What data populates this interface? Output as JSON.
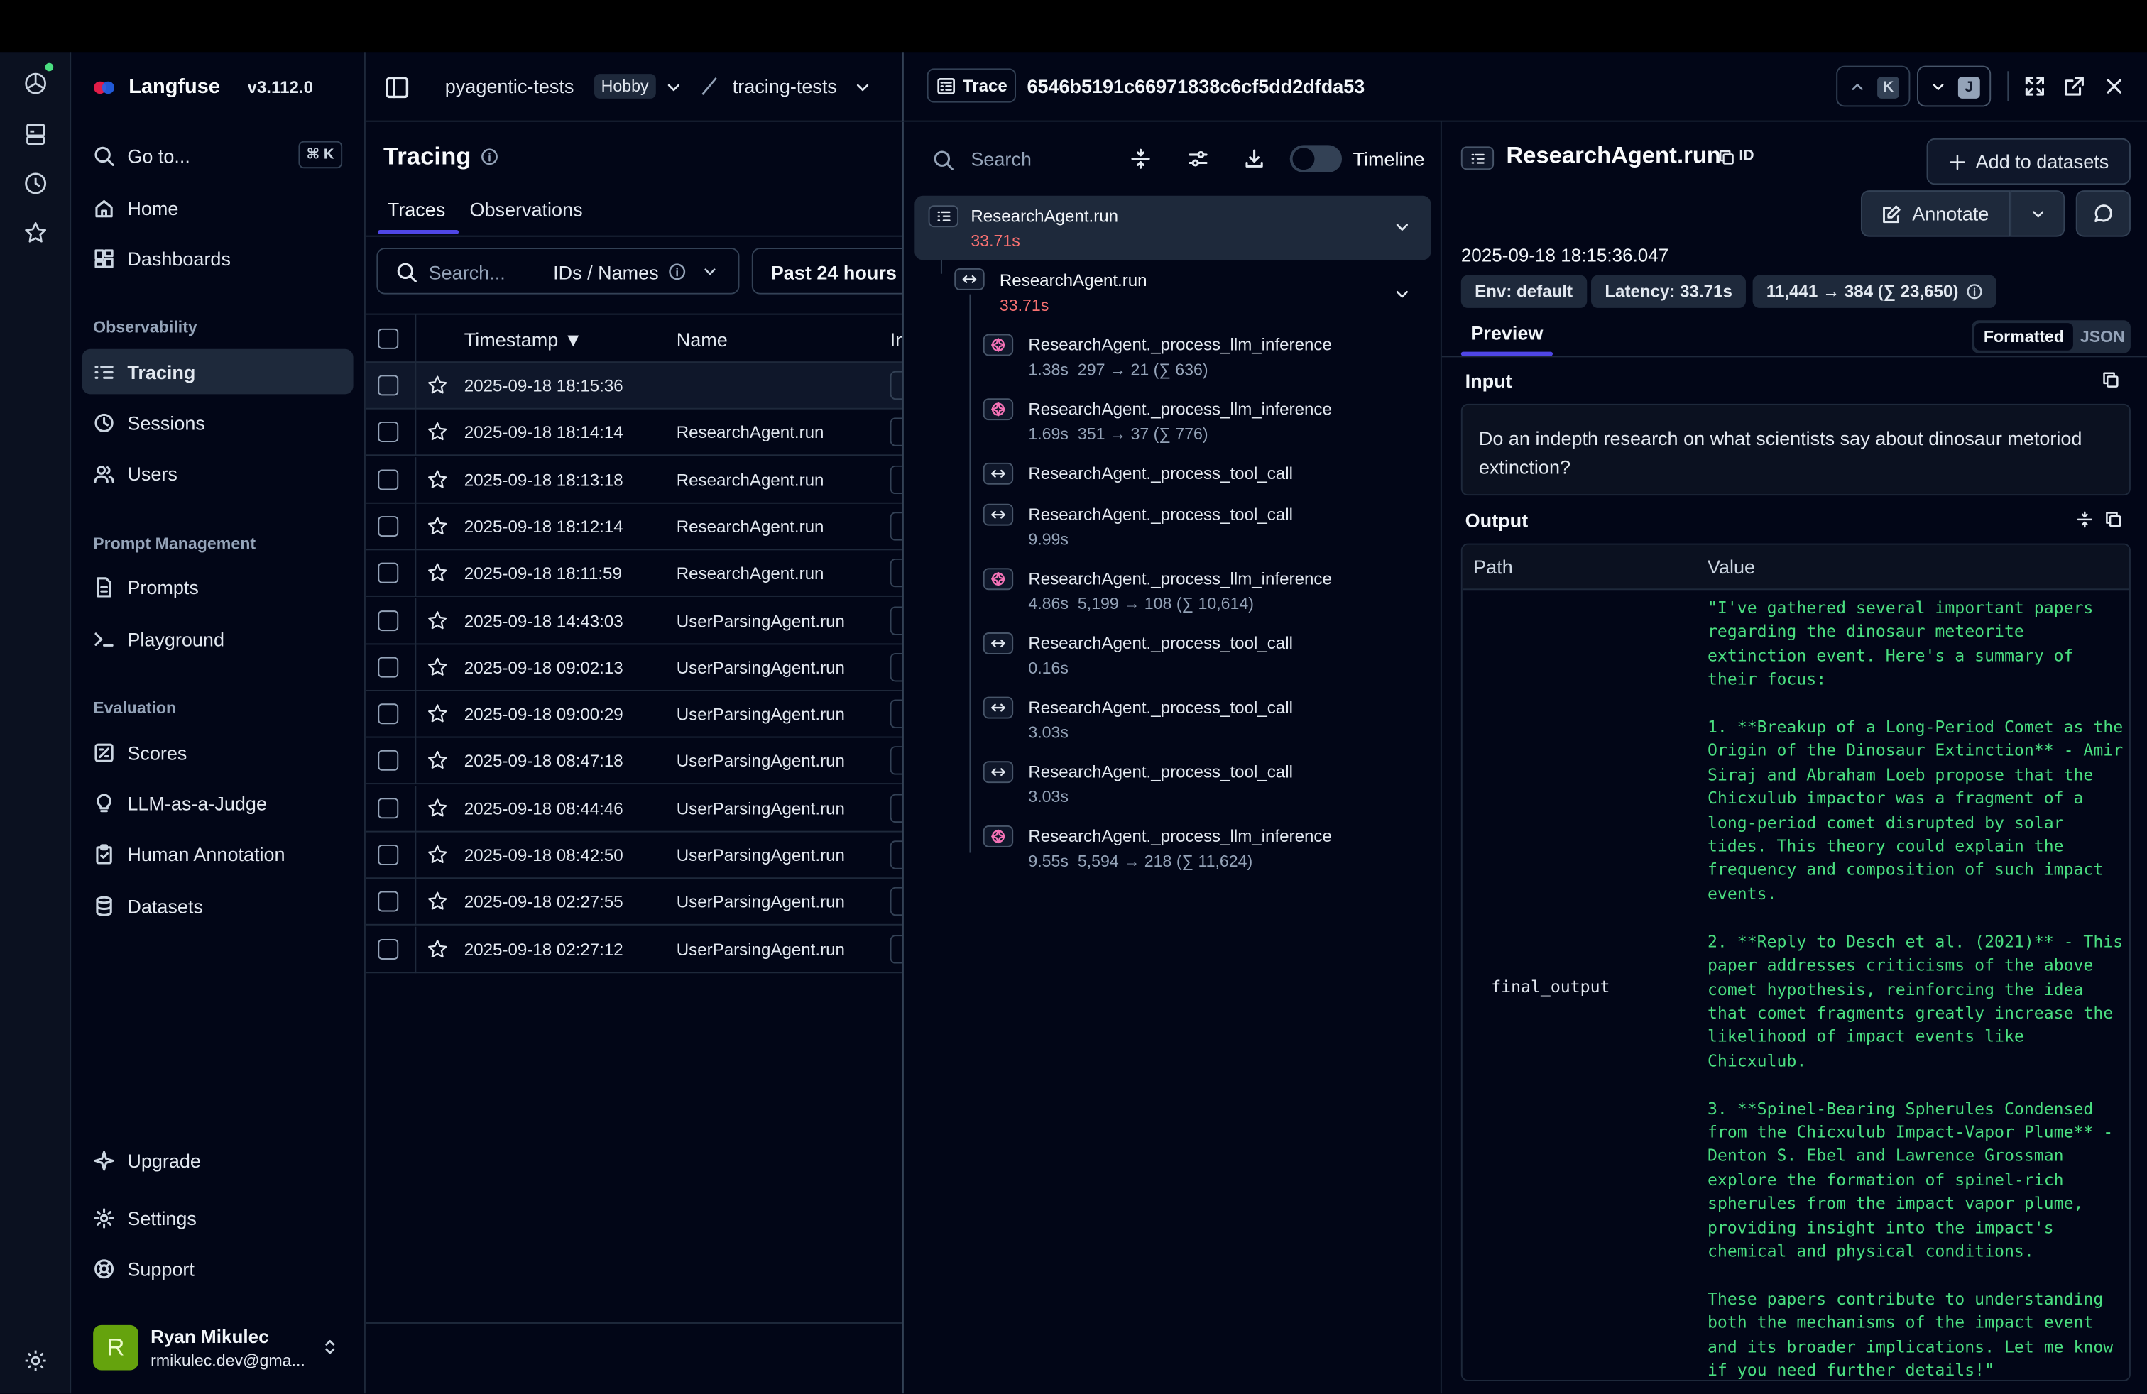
{
  "app": {
    "name": "Langfuse",
    "version": "v3.112.0"
  },
  "breadcrumb": {
    "project_org": "pyagentic-tests",
    "plan_badge": "Hobby",
    "project": "tracing-tests"
  },
  "sidebar": {
    "goto_label": "Go to...",
    "goto_shortcut": "⌘ K",
    "home": "Home",
    "dashboards": "Dashboards",
    "section_observability": "Observability",
    "tracing": "Tracing",
    "sessions": "Sessions",
    "users": "Users",
    "section_prompt": "Prompt Management",
    "prompts": "Prompts",
    "playground": "Playground",
    "section_evaluation": "Evaluation",
    "scores": "Scores",
    "llm_judge": "LLM-as-a-Judge",
    "human_annotation": "Human Annotation",
    "datasets": "Datasets",
    "upgrade": "Upgrade",
    "settings": "Settings",
    "support": "Support",
    "user": {
      "initial": "R",
      "name": "Ryan Mikulec",
      "email": "rmikulec.dev@gma..."
    }
  },
  "tracing": {
    "title": "Tracing",
    "tabs": [
      "Traces",
      "Observations"
    ],
    "search_placeholder": "Search...",
    "search_mode": "IDs / Names",
    "time_range": "Past 24 hours",
    "columns": {
      "timestamp": "Timestamp ▼",
      "name": "Name",
      "next": "In"
    },
    "rows": [
      {
        "timestamp": "2025-09-18 18:15:36",
        "name": ""
      },
      {
        "timestamp": "2025-09-18 18:14:14",
        "name": "ResearchAgent.run"
      },
      {
        "timestamp": "2025-09-18 18:13:18",
        "name": "ResearchAgent.run"
      },
      {
        "timestamp": "2025-09-18 18:12:14",
        "name": "ResearchAgent.run"
      },
      {
        "timestamp": "2025-09-18 18:11:59",
        "name": "ResearchAgent.run"
      },
      {
        "timestamp": "2025-09-18 14:43:03",
        "name": "UserParsingAgent.run"
      },
      {
        "timestamp": "2025-09-18 09:02:13",
        "name": "UserParsingAgent.run"
      },
      {
        "timestamp": "2025-09-18 09:00:29",
        "name": "UserParsingAgent.run"
      },
      {
        "timestamp": "2025-09-18 08:47:18",
        "name": "UserParsingAgent.run"
      },
      {
        "timestamp": "2025-09-18 08:44:46",
        "name": "UserParsingAgent.run"
      },
      {
        "timestamp": "2025-09-18 08:42:50",
        "name": "UserParsingAgent.run"
      },
      {
        "timestamp": "2025-09-18 02:27:55",
        "name": "UserParsingAgent.run"
      },
      {
        "timestamp": "2025-09-18 02:27:12",
        "name": "UserParsingAgent.run"
      }
    ]
  },
  "trace": {
    "type_label": "Trace",
    "id": "6546b5191c66971838c6cf5dd2dfda53",
    "nav_up_key": "K",
    "nav_down_key": "J"
  },
  "tree": {
    "search_placeholder": "Search",
    "timeline_label": "Timeline",
    "root": {
      "name": "ResearchAgent.run",
      "latency": "33.71s"
    },
    "span": {
      "name": "ResearchAgent.run",
      "latency": "33.71s"
    },
    "children": [
      {
        "kind": "generation",
        "name": "ResearchAgent._process_llm_inference",
        "info": "1.38s  297 → 21 (∑ 636)"
      },
      {
        "kind": "generation",
        "name": "ResearchAgent._process_llm_inference",
        "info": "1.69s  351 → 37 (∑ 776)"
      },
      {
        "kind": "span",
        "name": "ResearchAgent._process_tool_call",
        "info": ""
      },
      {
        "kind": "span",
        "name": "ResearchAgent._process_tool_call",
        "info": "9.99s"
      },
      {
        "kind": "generation",
        "name": "ResearchAgent._process_llm_inference",
        "info": "4.86s  5,199 → 108 (∑ 10,614)"
      },
      {
        "kind": "span",
        "name": "ResearchAgent._process_tool_call",
        "info": "0.16s"
      },
      {
        "kind": "span",
        "name": "ResearchAgent._process_tool_call",
        "info": "3.03s"
      },
      {
        "kind": "span",
        "name": "ResearchAgent._process_tool_call",
        "info": "3.03s"
      },
      {
        "kind": "generation",
        "name": "ResearchAgent._process_llm_inference",
        "info": "9.55s  5,594 → 218 (∑ 11,624)"
      }
    ]
  },
  "detail": {
    "title": "ResearchAgent.run",
    "id_label": "ID",
    "add_to_datasets": "Add to datasets",
    "annotate": "Annotate",
    "timestamp": "2025-09-18 18:15:36.047",
    "env": "Env: default",
    "latency": "Latency: 33.71s",
    "tokens": "11,441 → 384 (∑ 23,650)",
    "tab_preview": "Preview",
    "toggle_formatted": "Formatted",
    "toggle_json": "JSON",
    "input_label": "Input",
    "input_text": "Do an indepth research on what scientists say about dinosaur metoriod extinction?",
    "output_label": "Output",
    "col_path": "Path",
    "col_value": "Value",
    "output_path": "final_output",
    "output_value": "\"I've gathered several important papers\nregarding the dinosaur meteorite\nextinction event. Here's a summary of\ntheir focus:\n\n1. **Breakup of a Long-Period Comet as the\nOrigin of the Dinosaur Extinction** - Amir\nSiraj and Abraham Loeb propose that the\nChicxulub impactor was a fragment of a\nlong-period comet disrupted by solar\ntides. This theory could explain the\nfrequency and composition of such impact\nevents.\n\n2. **Reply to Desch et al. (2021)** - This\npaper addresses criticisms of the above\ncomet hypothesis, reinforcing the idea\nthat comet fragments greatly increase the\nlikelihood of impact events like\nChicxulub.\n\n3. **Spinel-Bearing Spherules Condensed\nfrom the Chicxulub Impact-Vapor Plume** -\nDenton S. Ebel and Lawrence Grossman\nexplore the formation of spinel-rich\nspherules from the impact vapor plume,\nproviding insight into the impact's\nchemical and physical conditions.\n\nThese papers contribute to understanding\nboth the mechanisms of the impact event\nand its broader implications. Let me know\nif you need further details!\""
  },
  "colors": {
    "accent_green": "#4ade80",
    "latency_red": "#f87171",
    "generation_pink": "#f472b6",
    "avatar_green": "#65a30d"
  }
}
